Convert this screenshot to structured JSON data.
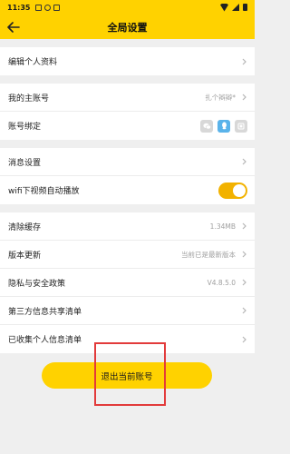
{
  "status_bar": {
    "time": "11:35"
  },
  "header": {
    "title": "全局设置"
  },
  "groups": [
    {
      "rows": [
        {
          "label": "编辑个人资料"
        }
      ]
    },
    {
      "rows": [
        {
          "label": "我的主账号",
          "value": "扎个辫辫*"
        },
        {
          "label": "账号绑定"
        }
      ]
    },
    {
      "rows": [
        {
          "label": "消息设置"
        },
        {
          "label": "wifi下视频自动播放"
        }
      ]
    },
    {
      "rows": [
        {
          "label": "清除缓存",
          "value": "1.34MB"
        },
        {
          "label": "版本更新",
          "value": "当前已是最新版本"
        },
        {
          "label": "隐私与安全政策",
          "value": "V4.8.5.0"
        },
        {
          "label": "第三方信息共享清单"
        },
        {
          "label": "已收集个人信息清单"
        }
      ]
    }
  ],
  "account_binding": {
    "icons": [
      "wechat-icon",
      "qq-icon",
      "weibo-icon"
    ],
    "active": "qq-icon"
  },
  "wifi_autoplay": {
    "enabled": true
  },
  "logout": {
    "label": "退出当前账号"
  },
  "colors": {
    "accent": "#ffd200",
    "toggle_on": "#f2b200",
    "highlight": "#e23b3b"
  }
}
